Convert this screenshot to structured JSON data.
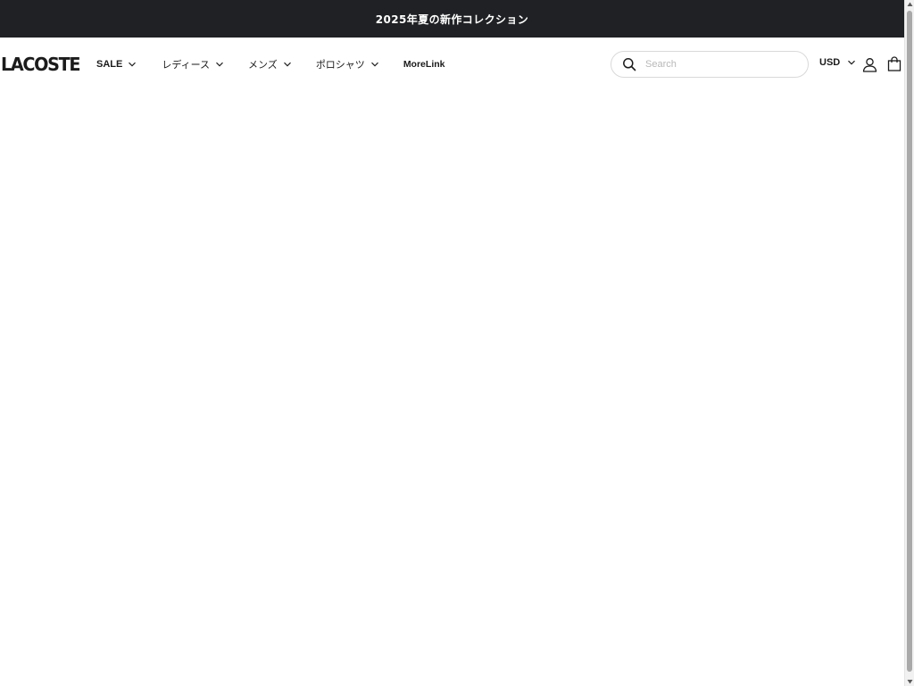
{
  "announcement": {
    "text": "2025年夏の新作コレクション"
  },
  "header": {
    "logo": "LACOSTE",
    "nav": [
      {
        "label": "SALE",
        "has_dropdown": true
      },
      {
        "label": "レディース",
        "has_dropdown": true
      },
      {
        "label": "メンズ",
        "has_dropdown": true
      },
      {
        "label": "ポロシャツ",
        "has_dropdown": true
      },
      {
        "label": "MoreLink",
        "has_dropdown": false
      }
    ],
    "search": {
      "placeholder": "Search",
      "value": ""
    },
    "currency": "USD"
  },
  "icons": {
    "search": "search-icon",
    "user": "user-icon",
    "bag": "shopping-bag-icon",
    "dropdown": "chevron-down-icon"
  },
  "colors": {
    "announcement_bg": "#1f2124",
    "announcement_text": "#ffffff",
    "text": "#1b1b1b",
    "search_border": "#d9d9d9"
  }
}
